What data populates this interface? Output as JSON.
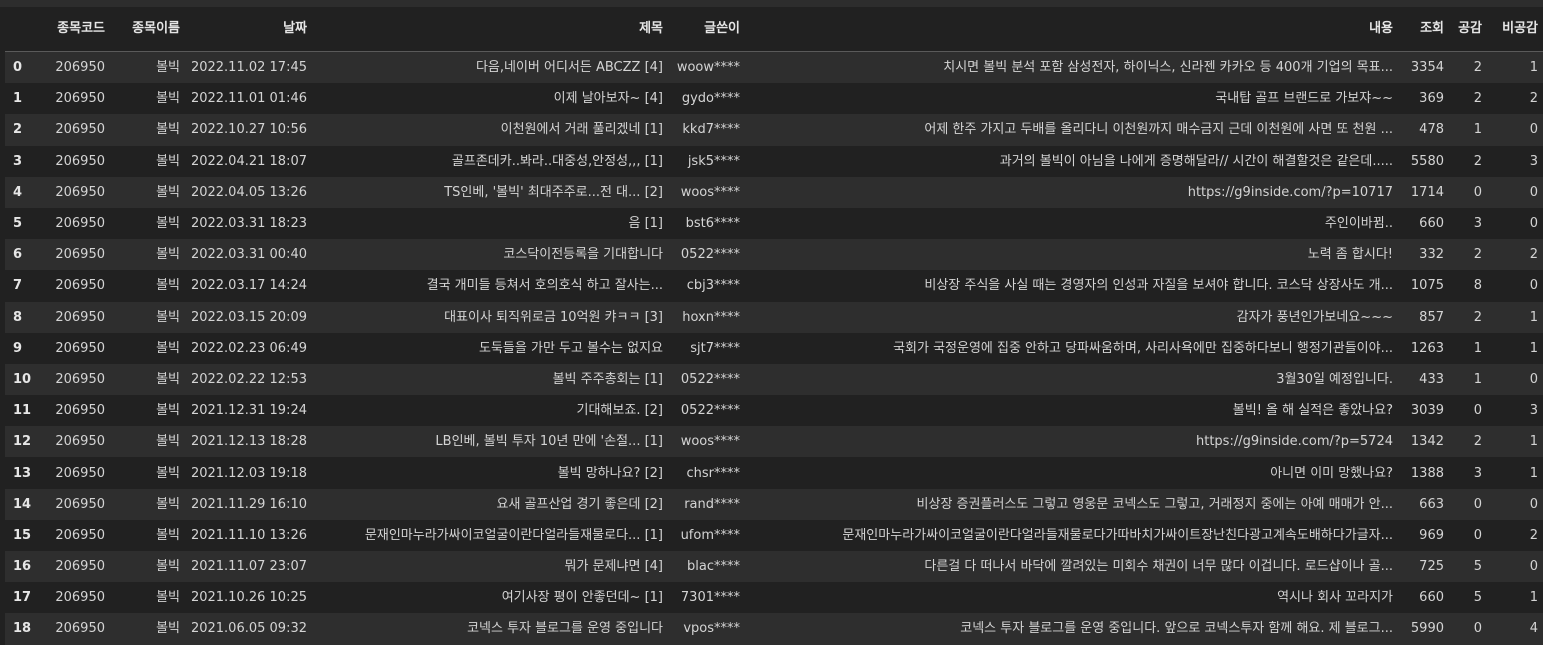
{
  "columns": [
    "종목코드",
    "종목이름",
    "날짜",
    "제목",
    "글쓴이",
    "내용",
    "조회",
    "공감",
    "비공감"
  ],
  "rows": [
    {
      "idx": "0",
      "code": "206950",
      "name": "볼빅",
      "date": "2022.11.02 17:45",
      "title": "다음,네이버 어디서든 ABCZZ [4]",
      "author": "woow****",
      "body": "치시면 볼빅 분석 포함 삼성전자, 하이닉스, 신라젠 카카오 등 400개 기업의 목표...",
      "views": "3354",
      "like": "2",
      "dislike": "1"
    },
    {
      "idx": "1",
      "code": "206950",
      "name": "볼빅",
      "date": "2022.11.01 01:46",
      "title": "이제 날아보자~ [4]",
      "author": "gydo****",
      "body": "국내탑 골프 브랜드로 가보쟈~~",
      "views": "369",
      "like": "2",
      "dislike": "2"
    },
    {
      "idx": "2",
      "code": "206950",
      "name": "볼빅",
      "date": "2022.10.27 10:56",
      "title": "이천원에서 거래 풀리겠네 [1]",
      "author": "kkd7****",
      "body": "어제 한주 가지고 두배를 올리다니 이천원까지 매수금지 근데 이천원에 사면 또 천원 ...",
      "views": "478",
      "like": "1",
      "dislike": "0"
    },
    {
      "idx": "3",
      "code": "206950",
      "name": "볼빅",
      "date": "2022.04.21 18:07",
      "title": "골프존데카..봐라..대중성,안정성,,, [1]",
      "author": "jsk5****",
      "body": "과거의 볼빅이 아님을 나에게 증명해달라// 시간이 해결할것은 같은데.....",
      "views": "5580",
      "like": "2",
      "dislike": "3"
    },
    {
      "idx": "4",
      "code": "206950",
      "name": "볼빅",
      "date": "2022.04.05 13:26",
      "title": "TS인베, '볼빅' 최대주주로...전 대... [2]",
      "author": "woos****",
      "body": "https://g9inside.com/?p=10717",
      "views": "1714",
      "like": "0",
      "dislike": "0"
    },
    {
      "idx": "5",
      "code": "206950",
      "name": "볼빅",
      "date": "2022.03.31 18:23",
      "title": "음 [1]",
      "author": "bst6****",
      "body": "주인이바뀜..",
      "views": "660",
      "like": "3",
      "dislike": "0"
    },
    {
      "idx": "6",
      "code": "206950",
      "name": "볼빅",
      "date": "2022.03.31 00:40",
      "title": "코스닥이전등록을 기대합니다",
      "author": "0522****",
      "body": "노력 좀 합시다!",
      "views": "332",
      "like": "2",
      "dislike": "2"
    },
    {
      "idx": "7",
      "code": "206950",
      "name": "볼빅",
      "date": "2022.03.17 14:24",
      "title": "결국 개미들 등쳐서 호의호식 하고 잘사는...",
      "author": "cbj3****",
      "body": "비상장 주식을 사실 때는 경영자의 인성과 자질을 보셔야 합니다. 코스닥 상장사도 개...",
      "views": "1075",
      "like": "8",
      "dislike": "0"
    },
    {
      "idx": "8",
      "code": "206950",
      "name": "볼빅",
      "date": "2022.03.15 20:09",
      "title": "대표이사 퇴직위로금 10억원 캬ㅋㅋ [3]",
      "author": "hoxn****",
      "body": "감자가 풍년인가보네요~~~",
      "views": "857",
      "like": "2",
      "dislike": "1"
    },
    {
      "idx": "9",
      "code": "206950",
      "name": "볼빅",
      "date": "2022.02.23 06:49",
      "title": "도둑들을 가만 두고 볼수는 없지요",
      "author": "sjt7****",
      "body": "국회가 국정운영에 집중 안하고 당파싸움하며, 사리사욕에만 집중하다보니 행정기관들이야...",
      "views": "1263",
      "like": "1",
      "dislike": "1"
    },
    {
      "idx": "10",
      "code": "206950",
      "name": "볼빅",
      "date": "2022.02.22 12:53",
      "title": "볼빅 주주총회는 [1]",
      "author": "0522****",
      "body": "3월30일 예정입니다.",
      "views": "433",
      "like": "1",
      "dislike": "0"
    },
    {
      "idx": "11",
      "code": "206950",
      "name": "볼빅",
      "date": "2021.12.31 19:24",
      "title": "기대해보죠. [2]",
      "author": "0522****",
      "body": "볼빅! 올 해 실적은 좋았나요?",
      "views": "3039",
      "like": "0",
      "dislike": "3"
    },
    {
      "idx": "12",
      "code": "206950",
      "name": "볼빅",
      "date": "2021.12.13 18:28",
      "title": "LB인베, 볼빅 투자 10년 만에 '손절... [1]",
      "author": "woos****",
      "body": "https://g9inside.com/?p=5724",
      "views": "1342",
      "like": "2",
      "dislike": "1"
    },
    {
      "idx": "13",
      "code": "206950",
      "name": "볼빅",
      "date": "2021.12.03 19:18",
      "title": "볼빅 망하나요? [2]",
      "author": "chsr****",
      "body": "아니면 이미 망했나요?",
      "views": "1388",
      "like": "3",
      "dislike": "1"
    },
    {
      "idx": "14",
      "code": "206950",
      "name": "볼빅",
      "date": "2021.11.29 16:10",
      "title": "요새 골프산업 경기 좋은데 [2]",
      "author": "rand****",
      "body": "비상장 증권플러스도 그렇고 영웅문 코넥스도 그렇고, 거래정지 중에는 아예 매매가 안...",
      "views": "663",
      "like": "0",
      "dislike": "0"
    },
    {
      "idx": "15",
      "code": "206950",
      "name": "볼빅",
      "date": "2021.11.10 13:26",
      "title": "문재인마누라가싸이코얼굴이란다얼라들재물로다... [1]",
      "author": "ufom****",
      "body": "문재인마누라가싸이코얼굴이란다얼라들재물로다가따바치가싸이트장난친다광고계속도배하다가글자...",
      "views": "969",
      "like": "0",
      "dislike": "2"
    },
    {
      "idx": "16",
      "code": "206950",
      "name": "볼빅",
      "date": "2021.11.07 23:07",
      "title": "뭐가 문제냐면 [4]",
      "author": "blac****",
      "body": "다른걸 다 떠나서 바닥에 깔려있는 미회수 채권이 너무 많다 이겁니다. 로드샵이나 골...",
      "views": "725",
      "like": "5",
      "dislike": "0"
    },
    {
      "idx": "17",
      "code": "206950",
      "name": "볼빅",
      "date": "2021.10.26 10:25",
      "title": "여기사장 평이 안좋던데~ [1]",
      "author": "7301****",
      "body": "역시나 회사 꼬라지가",
      "views": "660",
      "like": "5",
      "dislike": "1"
    },
    {
      "idx": "18",
      "code": "206950",
      "name": "볼빅",
      "date": "2021.06.05 09:32",
      "title": "코넥스 투자 블로그를 운영 중입니다",
      "author": "vpos****",
      "body": "코넥스 투자 블로그를 운영 중입니다. 앞으로 코넥스투자 함께 해요. 제 블로그...",
      "views": "5990",
      "like": "0",
      "dislike": "4"
    }
  ]
}
